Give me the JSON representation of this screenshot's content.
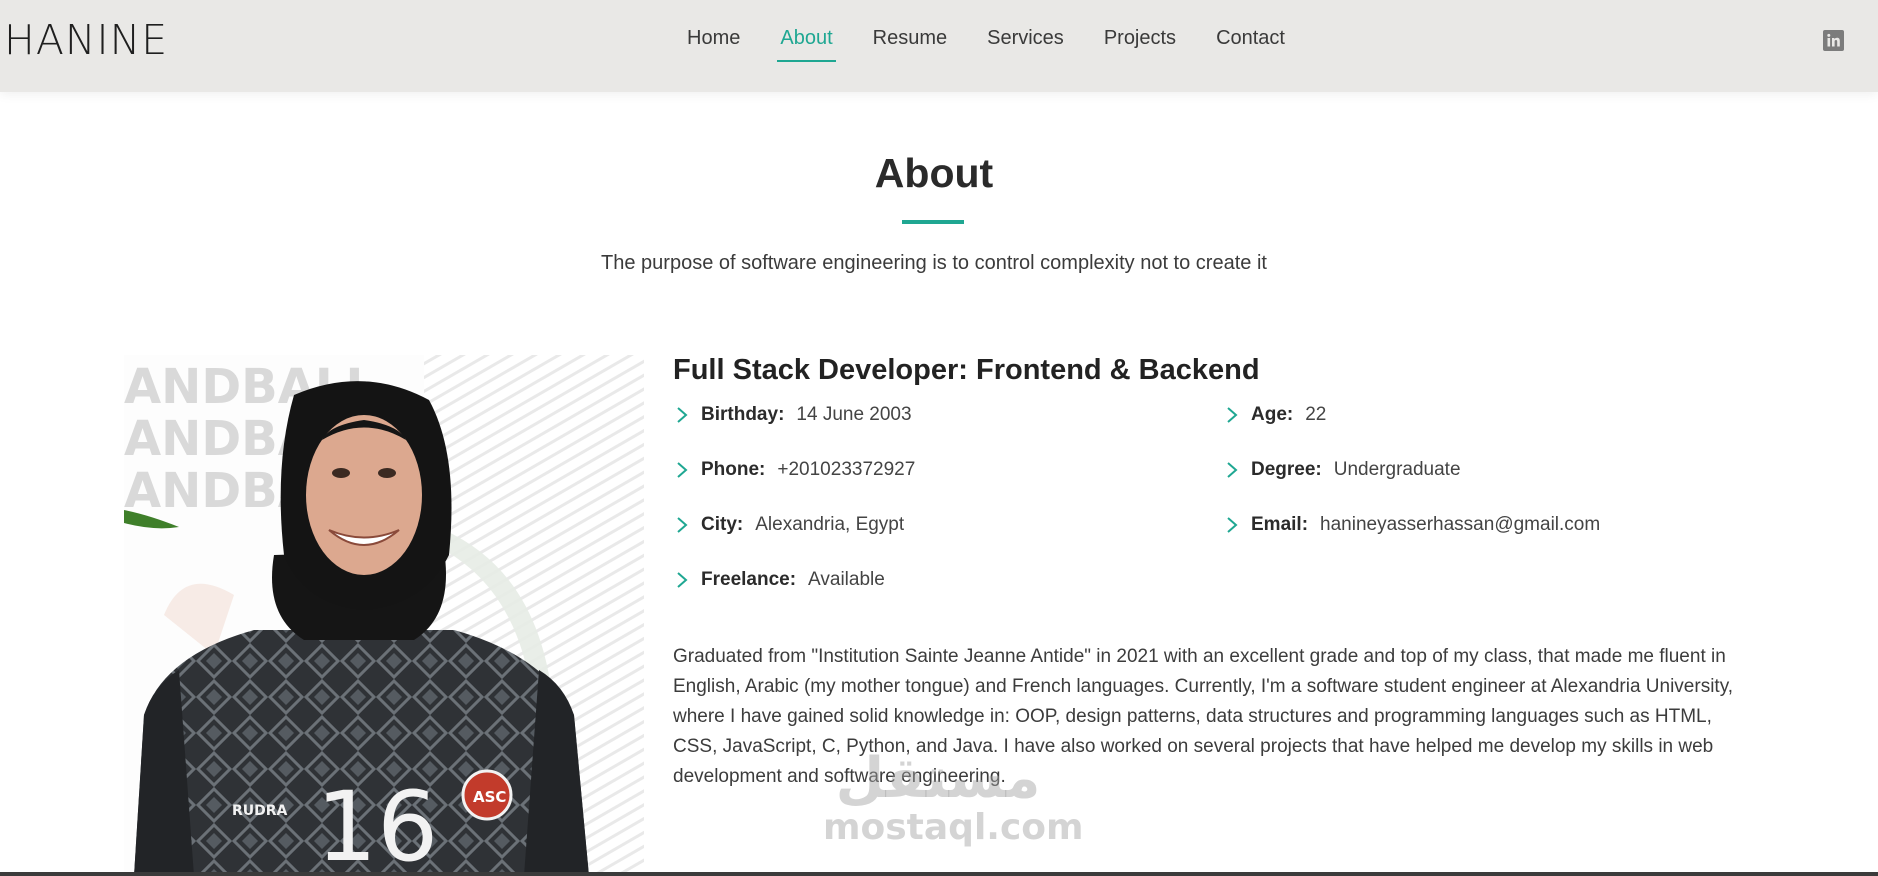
{
  "brand": {
    "logo_text": "HANINE"
  },
  "nav": {
    "items": [
      {
        "label": "Home",
        "active": false
      },
      {
        "label": "About",
        "active": true
      },
      {
        "label": "Resume",
        "active": false
      },
      {
        "label": "Services",
        "active": false
      },
      {
        "label": "Projects",
        "active": false
      },
      {
        "label": "Contact",
        "active": false
      }
    ]
  },
  "social": {
    "icon": "linkedin-icon",
    "glyph": "in"
  },
  "section": {
    "title": "About",
    "subtitle": "The purpose of software engineering is to control complexity not to create it"
  },
  "photo": {
    "bg_text": [
      "ANDBALL",
      "ANDBA",
      "ANDBA"
    ],
    "jersey_number": "16",
    "sponsor": "RUDRA",
    "badge": "ASC"
  },
  "profile": {
    "title": "Full Stack Developer: Frontend & Backend",
    "left": [
      {
        "label": "Birthday:",
        "value": "14 June 2003"
      },
      {
        "label": "Phone:",
        "value": "+201023372927"
      },
      {
        "label": "City:",
        "value": "Alexandria, Egypt"
      },
      {
        "label": "Freelance:",
        "value": "Available"
      }
    ],
    "right": [
      {
        "label": "Age:",
        "value": "22"
      },
      {
        "label": "Degree:",
        "value": "Undergraduate"
      },
      {
        "label": "Email:",
        "value": "hanineyasserhassan@gmail.com"
      }
    ],
    "bio": "Graduated from \"Institution Sainte Jeanne Antide\" in 2021 with an excellent grade and top of my class, that made me fluent in English, Arabic (my mother tongue) and French languages. Currently, I'm a software student engineer at Alexandria University, where I have gained solid knowledge in: OOP, design patterns, data structures and programming languages such as HTML, CSS, JavaScript, C, Python, and Java. I have also worked on several projects that have helped me develop my skills in web development and software engineering."
  },
  "watermark": {
    "arabic": "مستقل",
    "latin": "mostaql.com"
  },
  "colors": {
    "accent": "#1fa792",
    "header_bg": "#e9e8e6"
  }
}
